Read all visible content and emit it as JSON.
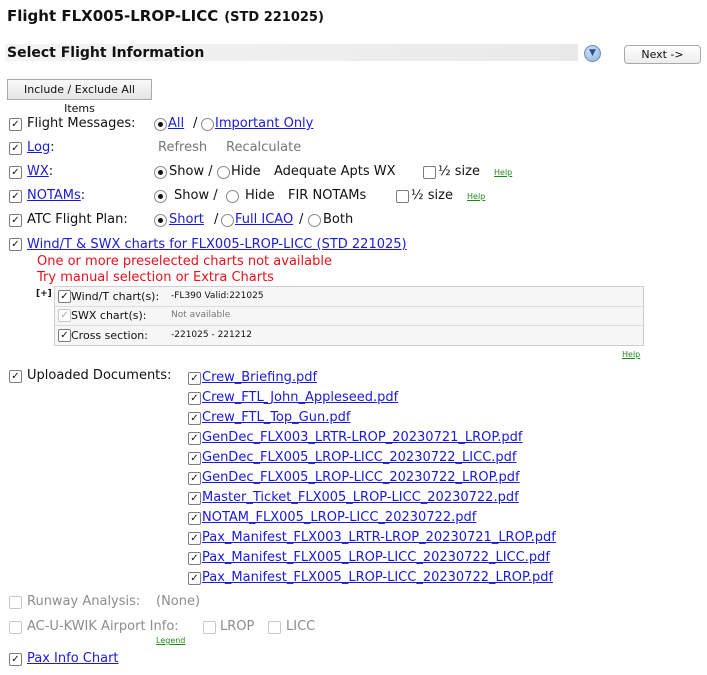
{
  "header": {
    "title": "Flight FLX005-LROP-LICC",
    "std": "(STD 221025)",
    "section_title": "Select Flight Information",
    "collapse_icon": "chevron-down-icon",
    "next_label": "Next ->",
    "include_exclude_label": "Include / Exclude All Items"
  },
  "rows": {
    "flight_messages": {
      "label": "Flight Messages:",
      "all": "All",
      "sep": "/",
      "important_only": "Important Only",
      "selected": "All"
    },
    "log": {
      "label": "Log",
      "colon": ":",
      "refresh": "Refresh",
      "recalculate": "Recalculate"
    },
    "wx": {
      "label": "WX",
      "colon": ":",
      "show": "Show /",
      "hide": "Hide",
      "adequate": "Adequate Apts WX",
      "half_size": "½ size",
      "help": "Help",
      "selected": "Show"
    },
    "notams": {
      "label": "NOTAMs",
      "colon": ":",
      "show": "Show /",
      "hide": "Hide",
      "fir": "FIR NOTAMs",
      "half_size": "½ size",
      "help": "Help",
      "selected": "Show"
    },
    "atc": {
      "label": "ATC Flight Plan:",
      "short": "Short",
      "sep": "/",
      "full_icao": "Full ICAO",
      "sep2": "/",
      "both": "Both",
      "selected": "Short"
    },
    "windt": {
      "label": "Wind/T & SWX charts for FLX005-LROP-LICC (STD 221025)",
      "error1": "One or more preselected charts not available",
      "error2": "Try manual selection or Extra Charts",
      "expand": "[+]",
      "charts": [
        {
          "label": "Wind/T chart(s):",
          "value": "-FL390 Valid:221025"
        },
        {
          "label": "SWX chart(s):",
          "value": "Not available"
        },
        {
          "label": "Cross section:",
          "value": "-221025 - 221212"
        }
      ],
      "help": "Help"
    },
    "uploaded": {
      "label": "Uploaded Documents:",
      "docs": [
        "Crew_Briefing.pdf",
        "Crew_FTL_John_Appleseed.pdf",
        "Crew_FTL_Top_Gun.pdf",
        "GenDec_FLX003_LRTR-LROP_20230721_LROP.pdf",
        "GenDec_FLX005_LROP-LICC_20230722_LICC.pdf",
        "GenDec_FLX005_LROP-LICC_20230722_LROP.pdf",
        "Master_Ticket_FLX005_LROP-LICC_20230722.pdf",
        "NOTAM_FLX005_LROP-LICC_20230722.pdf",
        "Pax_Manifest_FLX003_LRTR-LROP_20230721_LROP.pdf",
        "Pax_Manifest_FLX005_LROP-LICC_20230722_LICC.pdf",
        "Pax_Manifest_FLX005_LROP-LICC_20230722_LROP.pdf"
      ]
    },
    "runway": {
      "label": "Runway Analysis:",
      "value": "(None)"
    },
    "acukwik": {
      "label": "AC-U-KWIK Airport Info:",
      "legend": "Legend",
      "lrop": "LROP",
      "licc": "LICC"
    },
    "pax_info": {
      "label": "Pax Info Chart"
    }
  }
}
